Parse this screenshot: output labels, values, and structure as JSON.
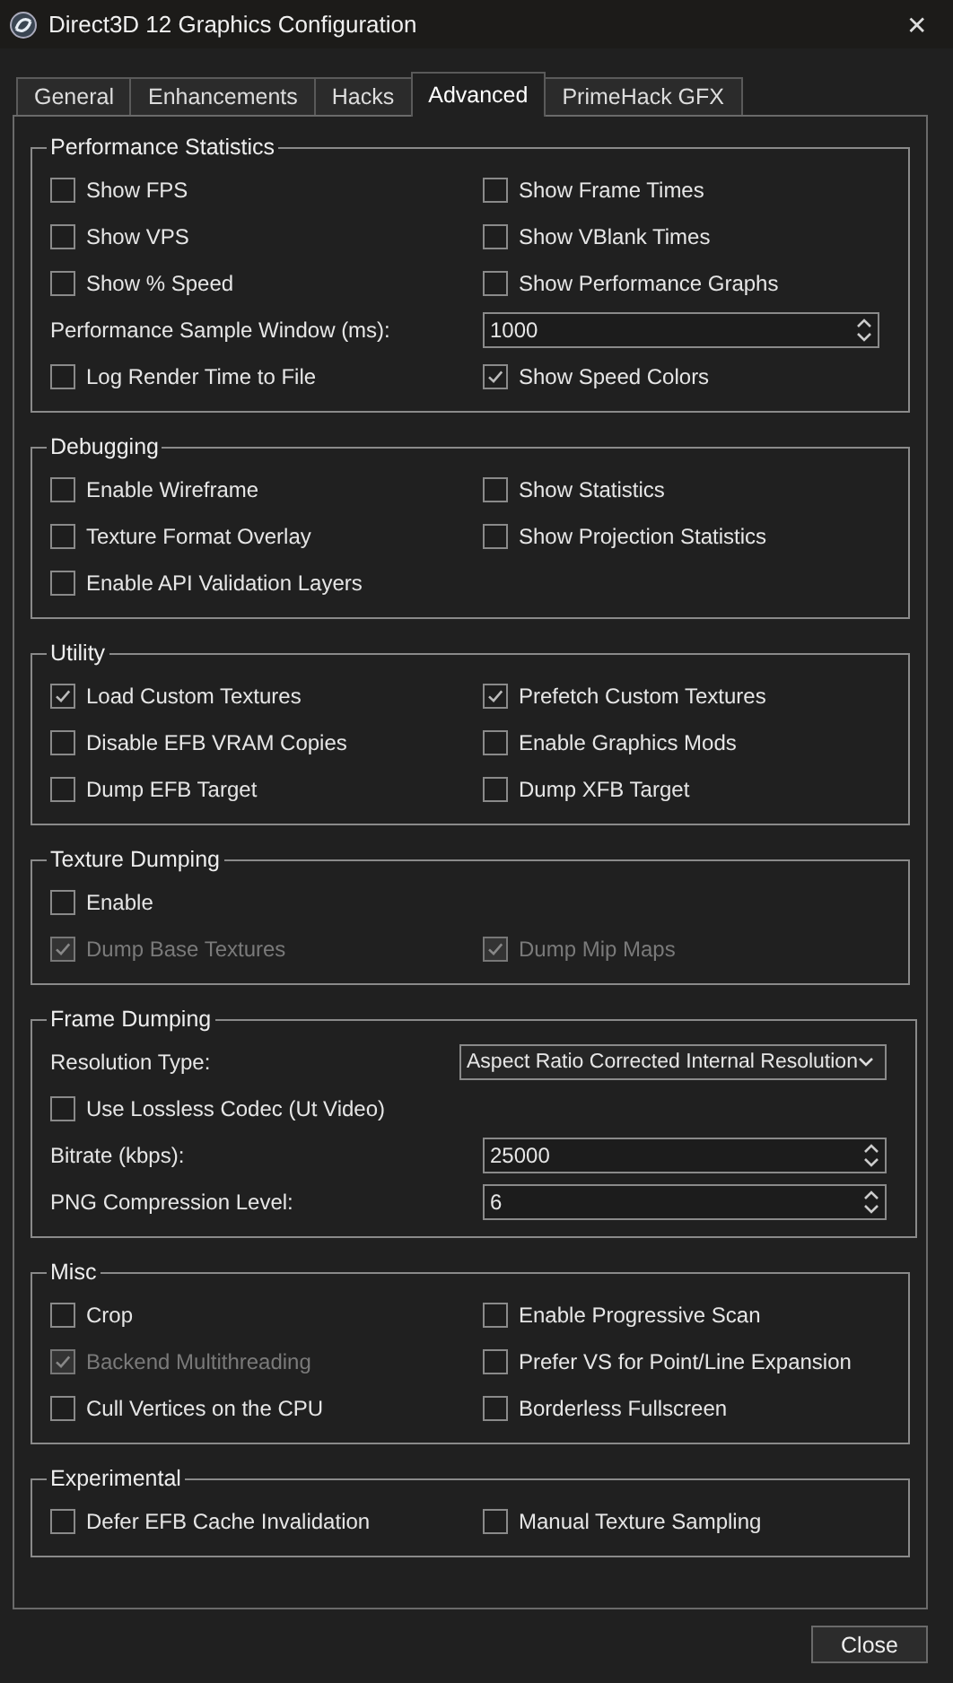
{
  "window": {
    "title": "Direct3D 12 Graphics Configuration",
    "close": "✕"
  },
  "tabs": [
    {
      "label": "General",
      "selected": false
    },
    {
      "label": "Enhancements",
      "selected": false
    },
    {
      "label": "Hacks",
      "selected": false
    },
    {
      "label": "Advanced",
      "selected": true
    },
    {
      "label": "PrimeHack GFX",
      "selected": false
    }
  ],
  "groups": [
    {
      "title": "Performance Statistics",
      "rows": [
        [
          {
            "kind": "checkbox",
            "label": "Show FPS",
            "checked": false,
            "disabled": false
          },
          {
            "kind": "checkbox",
            "label": "Show Frame Times",
            "checked": false,
            "disabled": false
          }
        ],
        [
          {
            "kind": "checkbox",
            "label": "Show VPS",
            "checked": false,
            "disabled": false
          },
          {
            "kind": "checkbox",
            "label": "Show VBlank Times",
            "checked": false,
            "disabled": false
          }
        ],
        [
          {
            "kind": "checkbox",
            "label": "Show % Speed",
            "checked": false,
            "disabled": false
          },
          {
            "kind": "checkbox",
            "label": "Show Performance Graphs",
            "checked": false,
            "disabled": false
          }
        ],
        [
          {
            "kind": "label",
            "label": "Performance Sample Window (ms):"
          },
          {
            "kind": "spinbox",
            "value": "1000"
          }
        ],
        [
          {
            "kind": "checkbox",
            "label": "Log Render Time to File",
            "checked": false,
            "disabled": false
          },
          {
            "kind": "checkbox",
            "label": "Show Speed Colors",
            "checked": true,
            "disabled": false
          }
        ]
      ]
    },
    {
      "title": "Debugging",
      "rows": [
        [
          {
            "kind": "checkbox",
            "label": "Enable Wireframe",
            "checked": false,
            "disabled": false
          },
          {
            "kind": "checkbox",
            "label": "Show Statistics",
            "checked": false,
            "disabled": false
          }
        ],
        [
          {
            "kind": "checkbox",
            "label": "Texture Format Overlay",
            "checked": false,
            "disabled": false
          },
          {
            "kind": "checkbox",
            "label": "Show Projection Statistics",
            "checked": false,
            "disabled": false
          }
        ],
        [
          {
            "kind": "checkbox",
            "label": "Enable API Validation Layers",
            "checked": false,
            "disabled": false
          }
        ]
      ]
    },
    {
      "title": "Utility",
      "rows": [
        [
          {
            "kind": "checkbox",
            "label": "Load Custom Textures",
            "checked": true,
            "disabled": false
          },
          {
            "kind": "checkbox",
            "label": "Prefetch Custom Textures",
            "checked": true,
            "disabled": false
          }
        ],
        [
          {
            "kind": "checkbox",
            "label": "Disable EFB VRAM Copies",
            "checked": false,
            "disabled": false
          },
          {
            "kind": "checkbox",
            "label": "Enable Graphics Mods",
            "checked": false,
            "disabled": false
          }
        ],
        [
          {
            "kind": "checkbox",
            "label": "Dump EFB Target",
            "checked": false,
            "disabled": false
          },
          {
            "kind": "checkbox",
            "label": "Dump XFB Target",
            "checked": false,
            "disabled": false
          }
        ]
      ]
    },
    {
      "title": "Texture Dumping",
      "rows": [
        [
          {
            "kind": "checkbox",
            "label": "Enable",
            "checked": false,
            "disabled": false
          }
        ],
        [
          {
            "kind": "checkbox",
            "label": "Dump Base Textures",
            "checked": true,
            "disabled": true
          },
          {
            "kind": "checkbox",
            "label": "Dump Mip Maps",
            "checked": true,
            "disabled": true
          }
        ]
      ]
    },
    {
      "title": "Frame Dumping",
      "rows": [
        [
          {
            "kind": "label",
            "label": "Resolution Type:"
          },
          {
            "kind": "select",
            "value": "Aspect Ratio Corrected Internal Resolution"
          }
        ],
        [
          {
            "kind": "checkbox",
            "label": "Use Lossless Codec (Ut Video)",
            "checked": false,
            "disabled": false
          }
        ],
        [
          {
            "kind": "label",
            "label": "Bitrate (kbps):"
          },
          {
            "kind": "spinbox",
            "value": "25000"
          }
        ],
        [
          {
            "kind": "label",
            "label": "PNG Compression Level:"
          },
          {
            "kind": "spinbox",
            "value": "6"
          }
        ]
      ]
    },
    {
      "title": "Misc",
      "rows": [
        [
          {
            "kind": "checkbox",
            "label": "Crop",
            "checked": false,
            "disabled": false
          },
          {
            "kind": "checkbox",
            "label": "Enable Progressive Scan",
            "checked": false,
            "disabled": false
          }
        ],
        [
          {
            "kind": "checkbox",
            "label": "Backend Multithreading",
            "checked": true,
            "disabled": true
          },
          {
            "kind": "checkbox",
            "label": "Prefer VS for Point/Line Expansion",
            "checked": false,
            "disabled": false
          }
        ],
        [
          {
            "kind": "checkbox",
            "label": "Cull Vertices on the CPU",
            "checked": false,
            "disabled": false
          },
          {
            "kind": "checkbox",
            "label": "Borderless Fullscreen",
            "checked": false,
            "disabled": false
          }
        ]
      ]
    },
    {
      "title": "Experimental",
      "rows": [
        [
          {
            "kind": "checkbox",
            "label": "Defer EFB Cache Invalidation",
            "checked": false,
            "disabled": false
          },
          {
            "kind": "checkbox",
            "label": "Manual Texture Sampling",
            "checked": false,
            "disabled": false
          }
        ]
      ]
    }
  ],
  "buttons": [
    "Close"
  ]
}
